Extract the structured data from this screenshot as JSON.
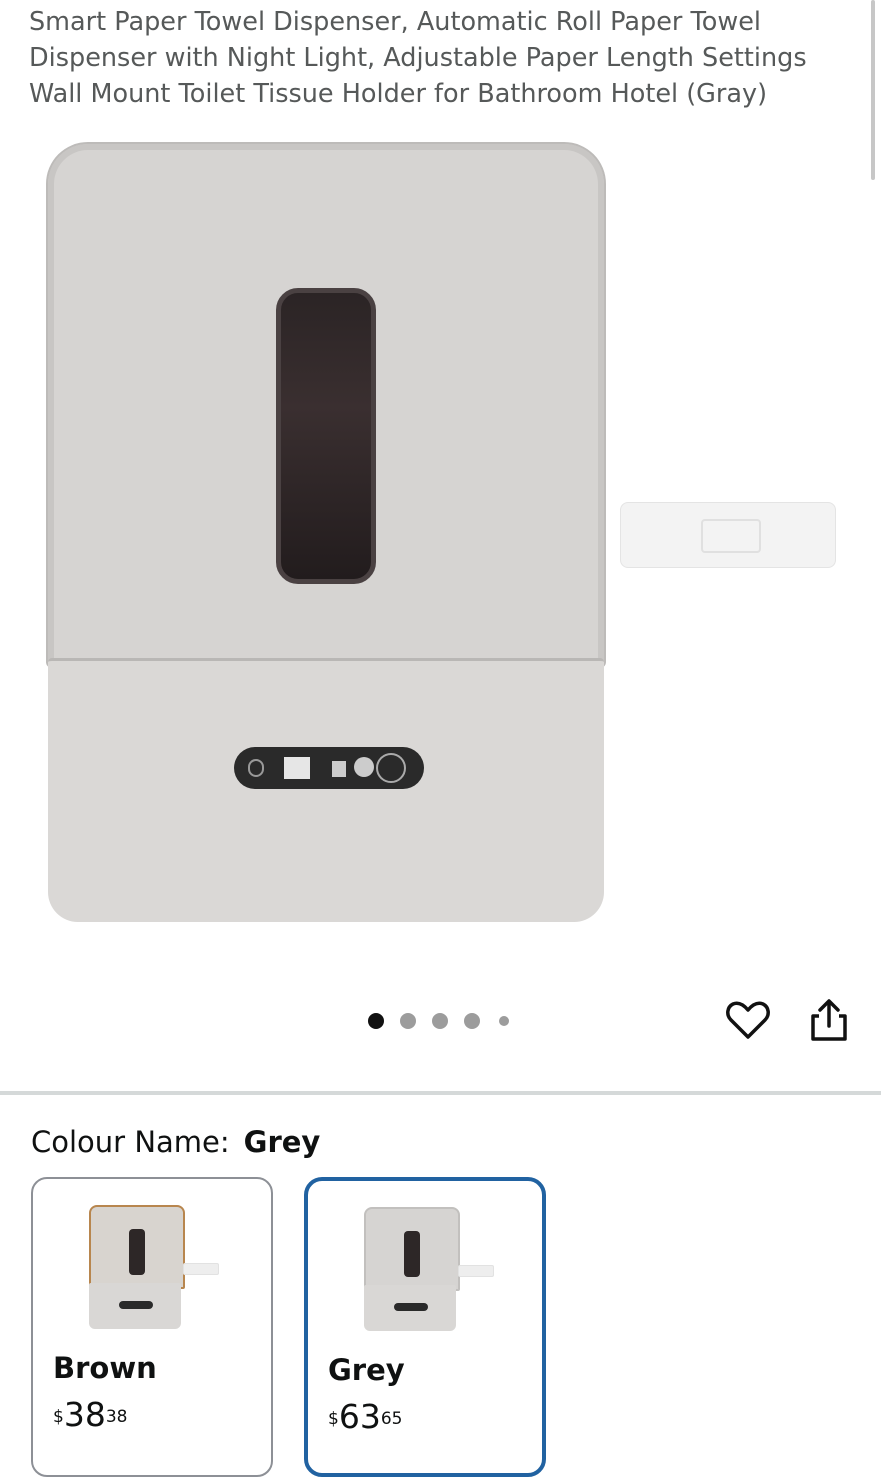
{
  "product": {
    "title": "Smart Paper Towel Dispenser, Automatic Roll Paper Towel Dispenser with Night Light, Adjustable Paper Length Settings Wall Mount Toilet Tissue Holder for Bathroom Hotel (Gray)"
  },
  "gallery": {
    "image_count": 5,
    "active_index": 0,
    "icons": {
      "favorite": "heart-icon",
      "share": "share-icon"
    }
  },
  "variant": {
    "label": "Colour Name:",
    "selected": "Grey",
    "options": [
      {
        "name": "Brown",
        "currency": "$",
        "price_whole": "38",
        "price_fraction": "38",
        "selected": false,
        "accent": "#b8864e"
      },
      {
        "name": "Grey",
        "currency": "$",
        "price_whole": "63",
        "price_fraction": "65",
        "selected": true,
        "accent": "#cfcdcb"
      }
    ]
  },
  "colors": {
    "selected_border": "#2162a1",
    "divider": "#d5d9d9",
    "title_text": "#565959"
  }
}
